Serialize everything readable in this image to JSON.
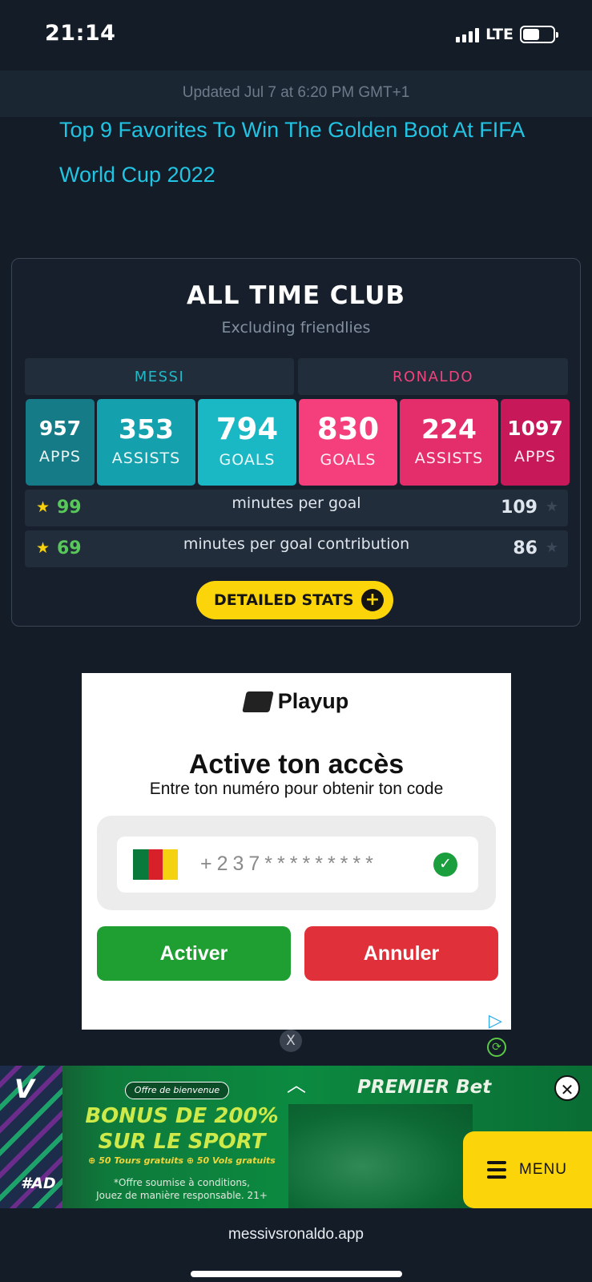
{
  "status_bar": {
    "time": "21:14",
    "network": "LTE",
    "battery_level_pct": 55
  },
  "update_banner": "Updated Jul 7 at 6:20 PM GMT+1",
  "article": {
    "link_text": "Top 9 Favorites To Win The Golden Boot At FIFA World Cup 2022"
  },
  "card": {
    "title": "ALL TIME CLUB",
    "subtitle": "Excluding friendlies",
    "messi_label": "MESSI",
    "ronaldo_label": "RONALDO",
    "stats": [
      {
        "value": "957",
        "label": "APPS"
      },
      {
        "value": "353",
        "label": "ASSISTS"
      },
      {
        "value": "794",
        "label": "GOALS"
      },
      {
        "value": "830",
        "label": "GOALS"
      },
      {
        "value": "224",
        "label": "ASSISTS"
      },
      {
        "value": "1097",
        "label": "APPS"
      }
    ],
    "rows": [
      {
        "messi": "99",
        "label": "minutes per goal",
        "ronaldo": "109"
      },
      {
        "messi": "69",
        "label": "minutes per goal contribution",
        "ronaldo": "86"
      }
    ],
    "detailed_button": "DETAILED STATS"
  },
  "ad": {
    "brand": "Playup",
    "title": "Active ton accès",
    "subtitle": "Entre ton numéro pour obtenir ton code",
    "phone_value": "+237*********",
    "activate_button": "Activer",
    "cancel_button": "Annuler",
    "close_label": "X"
  },
  "banner": {
    "side_label": "V",
    "ad_tag": "#AD",
    "offer_tag": "Offre de bienvenue",
    "bonus_line1": "BONUS DE 200%",
    "bonus_line2": "SUR LE SPORT",
    "extras": "⊕ 50 Tours gratuits ⊕ 50 Vols gratuits",
    "conditions_line1": "*Offre soumise à conditions,",
    "conditions_line2": "Jouez de manière responsable. 21+",
    "brand": "PREMIER Bet"
  },
  "menu_label": "MENU",
  "url": "messivsronaldo.app",
  "colors": {
    "messi_accent": "#1fb9c7",
    "ronaldo_accent": "#f0437c",
    "highlight_yellow": "#fbd50a",
    "link": "#22c4e3"
  }
}
